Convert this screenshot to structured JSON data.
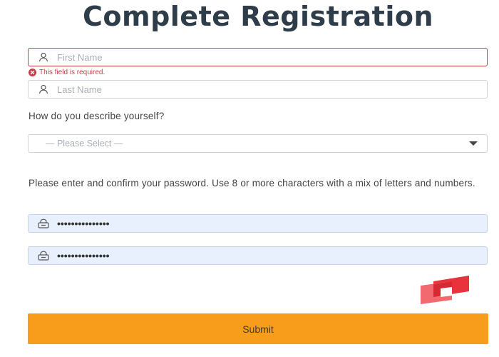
{
  "header": {
    "title": "Complete Registration"
  },
  "form": {
    "first_name": {
      "placeholder": "First Name",
      "value": "",
      "icon": "user-icon",
      "error": "This field is required."
    },
    "last_name": {
      "placeholder": "Last Name",
      "value": "",
      "icon": "user-icon"
    },
    "describe": {
      "question": "How do you describe yourself?",
      "selected": "— Please Select —",
      "icon": "caret-down-icon"
    },
    "password": {
      "instructions": "Please enter and confirm your password. Use 8 or more characters with a mix of letters and numbers.",
      "password_value": "•••••••••••••••",
      "confirm_value": "•••••••••••••••",
      "icon": "lock-icon"
    },
    "submit_label": "Submit"
  },
  "colors": {
    "title": "#2e3d49",
    "error": "#c73e4a",
    "autofill_bg": "#e8f0fe",
    "submit_bg": "#f89c1c",
    "logo_red": "#e8323c"
  }
}
